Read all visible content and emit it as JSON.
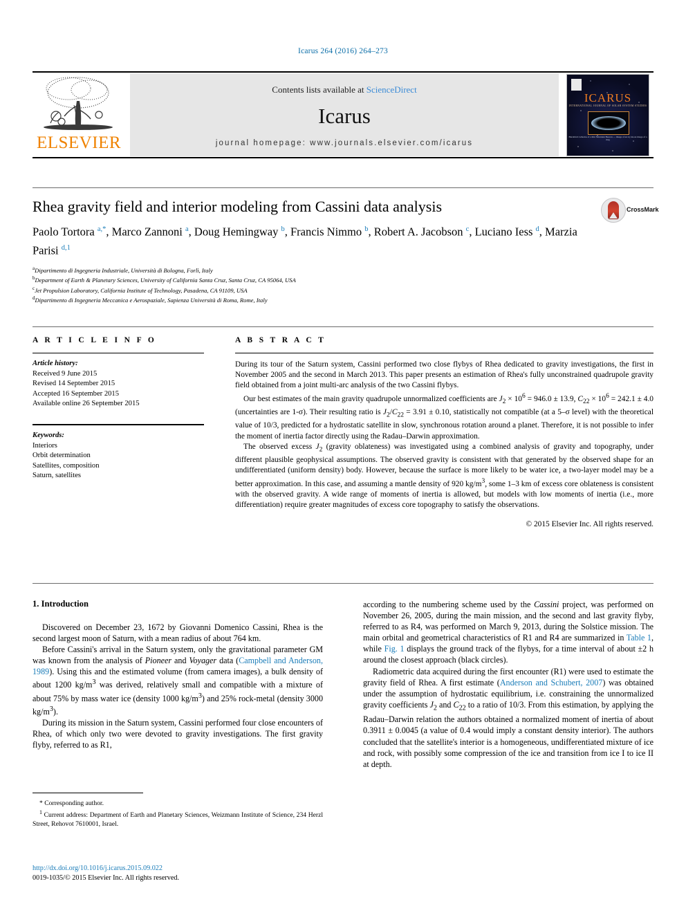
{
  "running_head": "Icarus 264 (2016) 264–273",
  "masthead": {
    "contents_prefix": "Contents lists available at ",
    "sciencedirect": "ScienceDirect",
    "journal_name": "Icarus",
    "homepage": "journal homepage: www.journals.elsevier.com/icarus",
    "publisher_wordmark": "ELSEVIER",
    "cover": {
      "title": "ICARUS",
      "subtitle": "INTERNATIONAL JOURNAL OF SOLAR SYSTEM STUDIES",
      "caption": "Blackbird: Albedos of a thin Saturnian Beacon — image of an icy moon image of a ring"
    }
  },
  "article": {
    "title": "Rhea gravity field and interior modeling from Cassini data analysis",
    "crossmark_label": "CrossMark",
    "authors_html": "Paolo Tortora <sup>a,*</sup>, Marco Zannoni <sup>a</sup>, Doug Hemingway <sup>b</sup>, Francis Nimmo <sup>b</sup>, Robert A. Jacobson <sup>c</sup>, Luciano Iess <sup>d</sup>, Marzia Parisi <sup>d,1</sup>",
    "affiliations": [
      {
        "marker": "a",
        "text": "Dipartimento di Ingegneria Industriale, Università di Bologna, Forlì, Italy"
      },
      {
        "marker": "b",
        "text": "Department of Earth & Planetary Sciences, University of California Santa Cruz, Santa Cruz, CA 95064, USA"
      },
      {
        "marker": "c",
        "text": "Jet Propulsion Laboratory, California Institute of Technology, Pasadena, CA 91109, USA"
      },
      {
        "marker": "d",
        "text": "Dipartimento di Ingegneria Meccanica e Aerospaziale, Sapienza Università di Roma, Rome, Italy"
      }
    ]
  },
  "article_info": {
    "heading": "A R T I C L E  I N F O",
    "history_label": "Article history:",
    "history": [
      "Received 9 June 2015",
      "Revised 14 September 2015",
      "Accepted 16 September 2015",
      "Available online 26 September 2015"
    ],
    "keywords_label": "Keywords:",
    "keywords": [
      "Interiors",
      "Orbit determination",
      "Satellites, composition",
      "Saturn, satellites"
    ]
  },
  "abstract": {
    "heading": "A B S T R A C T",
    "paragraphs_html": [
      "During its tour of the Saturn system, Cassini performed two close flybys of Rhea dedicated to gravity investigations, the first in November 2005 and the second in March 2013. This paper presents an estimation of Rhea's fully unconstrained quadrupole gravity field obtained from a joint multi-arc analysis of the two Cassini flybys.",
      "Our best estimates of the main gravity quadrupole unnormalized coefficients are <i>J</i><sub>2</sub> × 10<sup>6</sup> = 946.0 ± 13.9, <i>C</i><sub>22</sub> × 10<sup>6</sup> = 242.1 ± 4.0 (uncertainties are 1-σ). Their resulting ratio is <i>J</i><sub>2</sub>/<i>C</i><sub>22</sub> = 3.91 ± 0.10, statistically not compatible (at a 5–σ level) with the theoretical value of 10/3, predicted for a hydrostatic satellite in slow, synchronous rotation around a planet. Therefore, it is not possible to infer the moment of inertia factor directly using the Radau–Darwin approximation.",
      "The observed excess <i>J</i><sub>2</sub> (gravity oblateness) was investigated using a combined analysis of gravity and topography, under different plausible geophysical assumptions. The observed gravity is consistent with that generated by the observed shape for an undifferentiated (uniform density) body. However, because the surface is more likely to be water ice, a two-layer model may be a better approximation. In this case, and assuming a mantle density of 920 kg/m<sup>3</sup>, some 1–3 km of excess core oblateness is consistent with the observed gravity. A wide range of moments of inertia is allowed, but models with low moments of inertia (i.e., more differentiation) require greater magnitudes of excess core topography to satisfy the observations."
    ],
    "copyright": "© 2015 Elsevier Inc. All rights reserved."
  },
  "introduction": {
    "heading": "1. Introduction",
    "left_paragraphs_html": [
      "Discovered on December 23, 1672 by Giovanni Domenico Cassini, Rhea is the second largest moon of Saturn, with a mean radius of about 764 km.",
      "Before Cassini's arrival in the Saturn system, only the gravitational parameter GM was known from the analysis of <i>Pioneer</i> and <i>Voyager</i> data (<span class=\"lnk\">Campbell and Anderson, 1989</span>). Using this and the estimated volume (from camera images), a bulk density of about 1200 kg/m<sup>3</sup> was derived, relatively small and compatible with a mixture of about 75% by mass water ice (density 1000 kg/m<sup>3</sup>) and 25% rock-metal (density 3000 kg/m<sup>3</sup>).",
      "During its mission in the Saturn system, Cassini performed four close encounters of Rhea, of which only two were devoted to gravity investigations. The first gravity flyby, referred to as R1,"
    ],
    "right_paragraphs_html": [
      "according to the numbering scheme used by the <i>Cassini</i> project, was performed on November 26, 2005, during the main mission, and the second and last gravity flyby, referred to as R4, was performed on March 9, 2013, during the Solstice mission. The main orbital and geometrical characteristics of R1 and R4 are summarized in <span class=\"lnk\">Table 1</span>, while <span class=\"lnk\">Fig. 1</span> displays the ground track of the flybys, for a time interval of about ±2 h around the closest approach (black circles).",
      "Radiometric data acquired during the first encounter (R1) were used to estimate the gravity field of Rhea. A first estimate (<span class=\"lnk\">Anderson and Schubert, 2007</span>) was obtained under the assumption of hydrostatic equilibrium, i.e. constraining the unnormalized gravity coefficients <i>J</i><sub>2</sub> and <i>C</i><sub>22</sub> to a ratio of 10/3. From this estimation, by applying the Radau–Darwin relation the authors obtained a normalized moment of inertia of about 0.3911 ± 0.0045 (a value of 0.4 would imply a constant density interior). The authors concluded that the satellite's interior is a homogeneous, undifferentiated mixture of ice and rock, with possibly some compression of the ice and transition from ice I to ice II at depth."
    ]
  },
  "footnotes": {
    "corresponding": "* Corresponding author.",
    "current_address": "1 Current address: Department of Earth and Planetary Sciences, Weizmann Institute of Science, 234 Herzl Street, Rehovot 7610001, Israel.",
    "doi": "http://dx.doi.org/10.1016/j.icarus.2015.09.022",
    "issn_line": "0019-1035/© 2015 Elsevier Inc. All rights reserved."
  },
  "colors": {
    "link": "#1a7cb8",
    "elsevier_orange": "#ef8200",
    "masthead_gray": "#e6e6e6"
  }
}
